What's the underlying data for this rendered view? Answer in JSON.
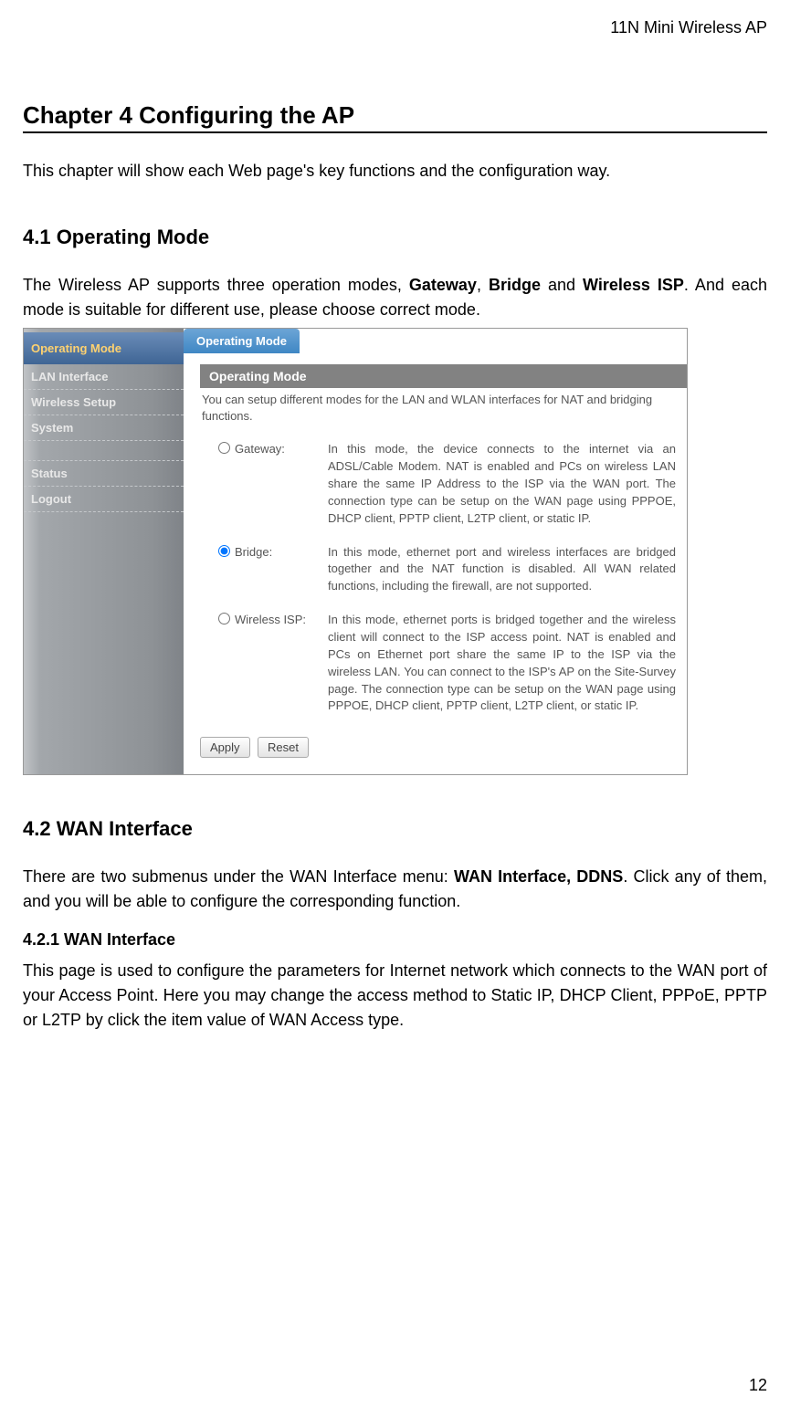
{
  "header": {
    "title": "11N Mini Wireless AP"
  },
  "chapter": {
    "title": "Chapter 4 Configuring the AP"
  },
  "intro": {
    "text": "This chapter will show each Web page's key functions and the configuration way."
  },
  "section41": {
    "title": "4.1 Operating Mode",
    "text_before": "The Wireless AP supports three operation modes, ",
    "mode1": "Gateway",
    "sep1": ", ",
    "mode2": "Bridge",
    "sep2": " and ",
    "mode3": "Wireless ISP",
    "text_after": ". And each mode is suitable for different use, please choose correct mode."
  },
  "screenshot": {
    "sidebar": {
      "items": [
        {
          "label": "Operating Mode",
          "active": true
        },
        {
          "label": "LAN Interface",
          "active": false
        },
        {
          "label": "Wireless Setup",
          "active": false
        },
        {
          "label": "System",
          "active": false
        },
        {
          "label": "Status",
          "active": false
        },
        {
          "label": "Logout",
          "active": false
        }
      ]
    },
    "tab_title": "Operating Mode",
    "panel_title": "Operating Mode",
    "panel_desc": "You can setup different modes for the LAN and WLAN interfaces for NAT and bridging functions.",
    "modes": [
      {
        "label": "Gateway:",
        "desc": "In this mode, the device connects to the internet via an ADSL/Cable Modem. NAT is enabled and PCs on wireless LAN share the same IP Address to the ISP via the WAN port. The connection type can be setup on the WAN page using PPPOE, DHCP client, PPTP client, L2TP client, or static IP.",
        "checked": false
      },
      {
        "label": "Bridge:",
        "desc": "In this mode, ethernet port and wireless interfaces are bridged together and the NAT function is disabled. All WAN related functions, including the firewall, are not supported.",
        "checked": true
      },
      {
        "label": "Wireless ISP:",
        "desc": "In this mode, ethernet ports is bridged together and the wireless client will connect to the ISP access point. NAT is enabled and PCs on Ethernet port share the same IP to the ISP via the wireless LAN. You can connect to the ISP's AP on the Site-Survey page. The connection type can be setup on the WAN page using PPPOE, DHCP client, PPTP client, L2TP client, or static IP.",
        "checked": false
      }
    ],
    "buttons": {
      "apply": "Apply",
      "reset": "Reset"
    }
  },
  "section42": {
    "title": "4.2 WAN Interface",
    "text_before": "There are two submenus under the WAN Interface menu: ",
    "bold_part": "WAN Interface, DDNS",
    "text_after": ". Click any of them, and you will be able to configure the corresponding function."
  },
  "section421": {
    "title": "4.2.1 WAN Interface",
    "text": "This page is used to configure the parameters for Internet network which connects to the WAN port of your Access Point. Here you may change the access method to Static IP, DHCP Client, PPPoE, PPTP or L2TP by click the item value of WAN Access type."
  },
  "page_number": "12"
}
